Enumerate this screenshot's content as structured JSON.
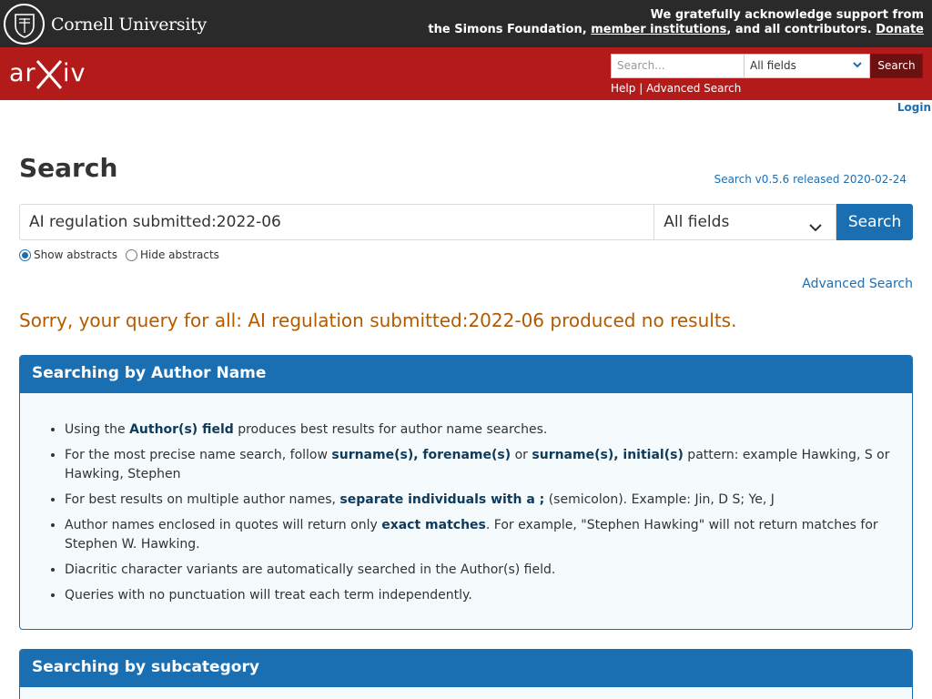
{
  "cornell": {
    "name": "Cornell University",
    "support_line1": "We gratefully acknowledge support from",
    "support_prefix": "the Simons Foundation,",
    "support_link": "member institutions",
    "support_mid": ", and all contributors.",
    "donate": "Donate"
  },
  "header": {
    "search_placeholder": "Search...",
    "field_select": "All fields",
    "search_button": "Search",
    "help": "Help",
    "separator": "|",
    "advanced": "Advanced Search"
  },
  "login": "Login",
  "page": {
    "title": "Search",
    "version": "Search v0.5.6 released 2020-02-24"
  },
  "search": {
    "query": "AI regulation submitted:2022-06",
    "field": "All fields",
    "button": "Search",
    "show_abstracts": "Show abstracts",
    "hide_abstracts": "Hide abstracts",
    "advanced_link": "Advanced Search"
  },
  "message": "Sorry, your query for all: AI regulation submitted:2022-06 produced no results.",
  "panels": {
    "author": {
      "title": "Searching by Author Name",
      "items": [
        [
          "Using the ",
          "Author(s) field",
          " produces best results for author name searches."
        ],
        [
          "For the most precise name search, follow ",
          "surname(s), forename(s)",
          " or ",
          "surname(s), initial(s)",
          " pattern: example Hawking, S or Hawking, Stephen"
        ],
        [
          "For best results on multiple author names, ",
          "separate individuals with a ;",
          " (semicolon). Example: Jin, D S; Ye, J"
        ],
        [
          "Author names enclosed in quotes will return only ",
          "exact matches",
          ". For example, \"Stephen Hawking\" will not return matches for Stephen W. Hawking."
        ],
        [
          "Diacritic character variants are automatically searched in the Author(s) field."
        ],
        [
          "Queries with no punctuation will treat each term independently."
        ]
      ]
    },
    "subcategory": {
      "title": "Searching by subcategory"
    }
  },
  "colors": {
    "arxiv_red": "#b31b1b",
    "cornell_dark": "#2a2a2a",
    "link_blue": "#1a6fb3",
    "warning_orange": "#b35a00"
  }
}
